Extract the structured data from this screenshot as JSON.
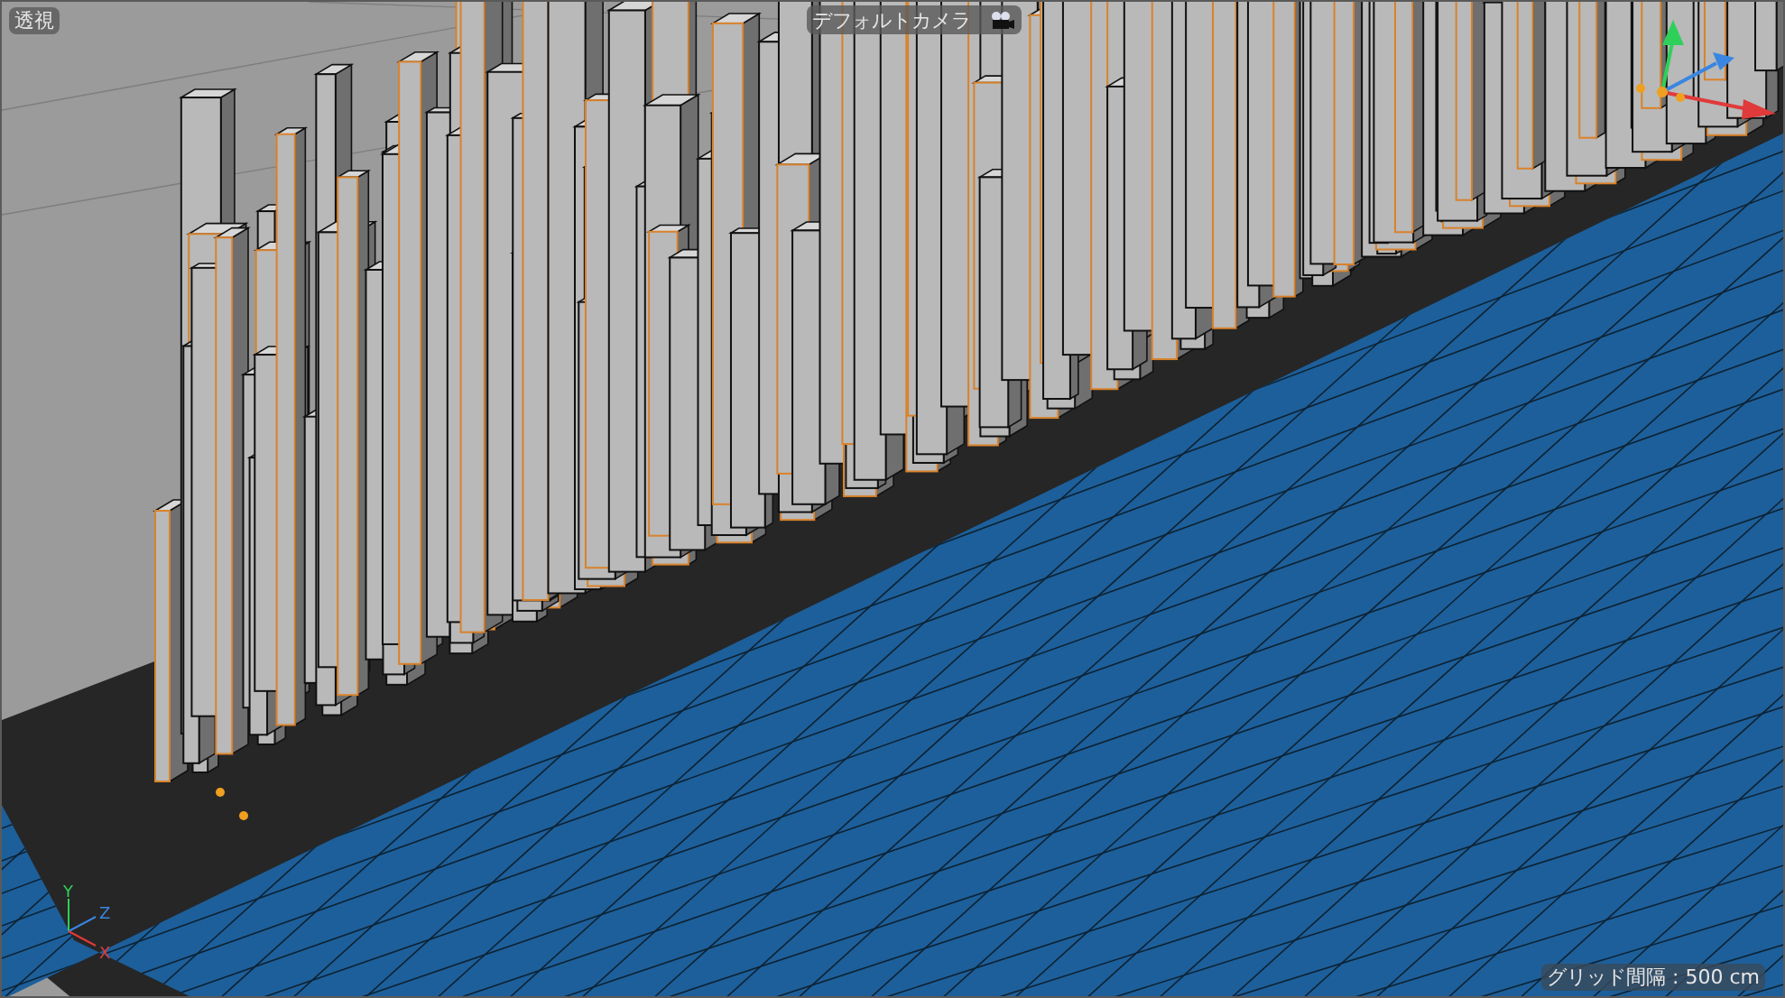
{
  "viewport": {
    "view_label": "透視",
    "camera_label": "デフォルトカメラ",
    "grid_spacing": "グリッド間隔 : 500 cm"
  },
  "axis_gizmo": {
    "y_label": "Y",
    "z_label": "Z",
    "x_label": "X"
  }
}
